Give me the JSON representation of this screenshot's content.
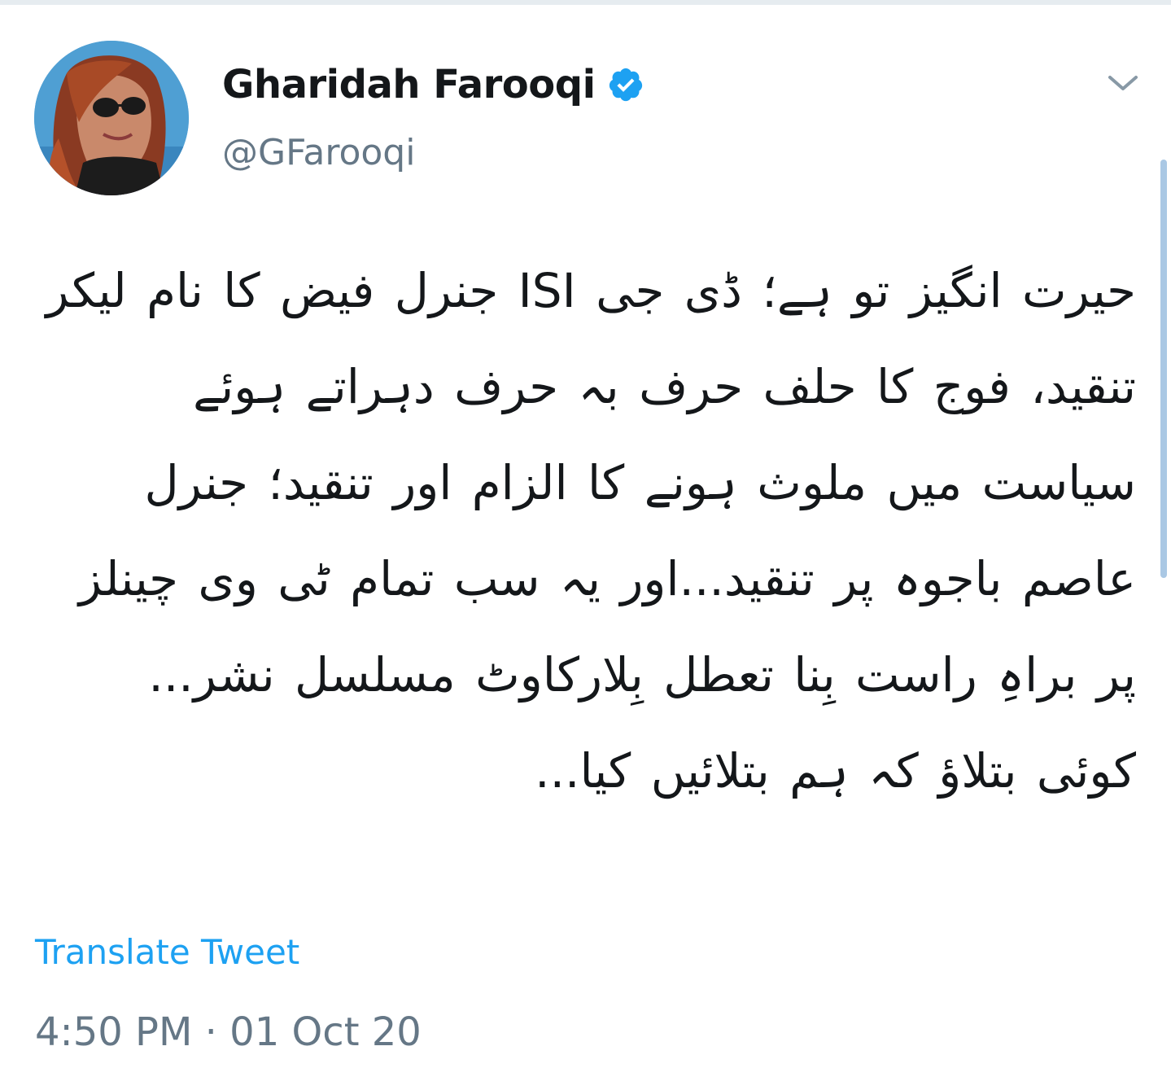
{
  "author": {
    "display_name": "Gharidah Farooqi",
    "handle": "@GFarooqi",
    "verified": true,
    "verified_icon": "verified-badge-icon"
  },
  "tweet": {
    "text": "حیرت انگیز تو ہے؛ ڈی جی ISI جنرل فیض کا نام لیکر تنقید، فوج کا حلف حرف بہ حرف دہراتے ہوئے سیاست میں ملوث ہونے کا الزام اور تنقید؛ جنرل عاصم باجوہ پر تنقید...اور یہ سب تمام ٹی وی چینلز پر براہِ راست بِنا تعطل بِلارکاوٹ مسلسل نشر... کوئی بتلاؤ کہ ہم بتلائیں کیا...",
    "translate_label": "Translate Tweet",
    "timestamp": "4:50 PM · 01 Oct 20"
  },
  "menu": {
    "icon": "chevron-down-icon"
  },
  "colors": {
    "link": "#1da1f2",
    "secondary_text": "#657786",
    "primary_text": "#14171a",
    "verified": "#1da1f2"
  }
}
